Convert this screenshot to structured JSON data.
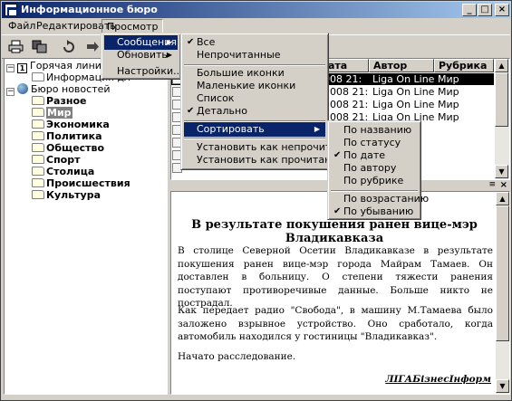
{
  "window": {
    "title": "Информационное бюро",
    "controls": {
      "minimize": "_",
      "maximize": "□",
      "close": "×"
    }
  },
  "menubar": {
    "items": [
      "Файл",
      "Редактировать",
      "Просмотр"
    ]
  },
  "toolbar": {
    "icons": [
      "print-icon",
      "copy-icon",
      "refresh-icon",
      "forward-icon"
    ]
  },
  "view_menu": {
    "items": [
      {
        "label": "Сообщения",
        "has_submenu": true,
        "highlighted": true
      },
      {
        "label": "Обновить",
        "has_submenu": true
      },
      {
        "label": "Настройки..."
      }
    ]
  },
  "messages_submenu": {
    "items": [
      {
        "label": "Все",
        "checked": true
      },
      {
        "label": "Непрочитанные"
      },
      {
        "label": "Большие иконки"
      },
      {
        "label": "Маленькие иконки"
      },
      {
        "label": "Список"
      },
      {
        "label": "Детально",
        "checked": true
      },
      {
        "label": "Сортировать",
        "has_submenu": true,
        "highlighted": true
      },
      {
        "label": "Установить как непрочитанное"
      },
      {
        "label": "Установить как прочитанное"
      }
    ]
  },
  "sort_submenu": {
    "items": [
      {
        "label": "По названию"
      },
      {
        "label": "По статусу"
      },
      {
        "label": "По дате",
        "checked": true
      },
      {
        "label": "По автору"
      },
      {
        "label": "По рубрике"
      },
      {
        "label": "По возрастанию"
      },
      {
        "label": "По убыванию",
        "checked": true
      }
    ]
  },
  "tree": {
    "hotline": {
      "number": "1",
      "label": "Горячая линия",
      "child": "Информация дл"
    },
    "bureau": {
      "label": "Бюро новостей",
      "items": [
        "Разное",
        "Мир",
        "Экономика",
        "Политика",
        "Общество",
        "Спорт",
        "Столица",
        "Происшествия",
        "Культура"
      ],
      "selected": "Мир"
    }
  },
  "list": {
    "columns": [
      "ата",
      "Автор",
      "Рубрика"
    ],
    "rows": [
      {
        "date": "008 21:",
        "author": "Liga On Line",
        "rubric": "Мир",
        "selected": true
      },
      {
        "date": "2008 21:",
        "author": "Liga On Line",
        "rubric": "Мир"
      },
      {
        "date": "2008 21:",
        "author": "Liga On Line",
        "rubric": "Мир"
      },
      {
        "date": "2008 21:",
        "author": "Liga On Line",
        "rubric": "Мир"
      }
    ]
  },
  "article": {
    "title": "В результате покушения ранен вице-мэр Владикавказа",
    "paragraphs": [
      "В столице Северной Осетии Владикавказе в результате покушения ранен вице-мэр города Майрам Тамаев. Он доставлен в больницу. О степени тяжести ранения поступают противоречивые данные. Больше никто не пострадал.",
      "Как передает радио \"Свобода\", в машину М.Тамаева было заложено взрывное устройство. Оно сработало, когда автомобиль находился у гостиницы \"Владикавказ\".",
      "Начато расследование."
    ],
    "signature": "ЛІГАБізнесІнформ"
  },
  "colors": {
    "title_bar": "#0a246a",
    "highlight": "#0a246a",
    "face": "#d4d0c8"
  }
}
